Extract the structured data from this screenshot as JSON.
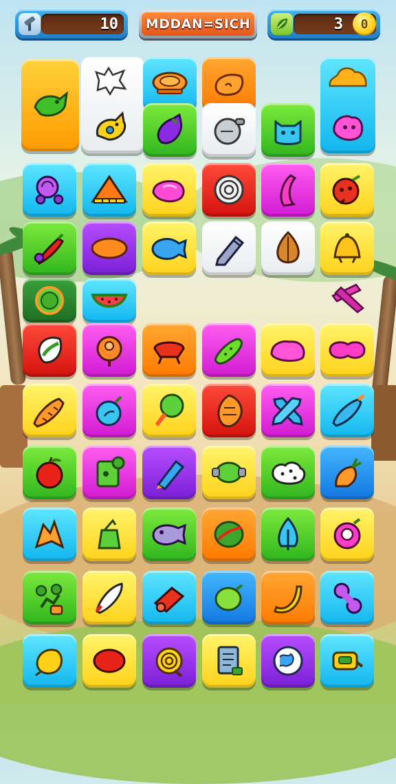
{
  "hud": {
    "title": "MDDAN=SICH",
    "left_counter": {
      "icon": "hammer-icon",
      "value": "10"
    },
    "right_counter": {
      "icon": "leaf-icon",
      "value": "3",
      "coin_label": "0"
    }
  },
  "colors": {
    "yellow": "#ffd21a",
    "orange": "#ff7a00",
    "cyan": "#12b6ee",
    "blue": "#1277e0",
    "green": "#2fb51e",
    "purple": "#7a1fd6",
    "magenta": "#d11ad3",
    "red": "#d4120e",
    "white": "#ffffff"
  },
  "board": {
    "tiles": [
      {
        "id": "t01",
        "color": "orangeyellow",
        "icon": "green-fish-icon"
      },
      {
        "id": "t02",
        "color": "white",
        "icon": "white-splat-icon"
      },
      {
        "id": "t03",
        "color": "cyan",
        "icon": "orange-bowl-icon"
      },
      {
        "id": "t04",
        "color": "orange",
        "icon": "orange-bean-icon"
      },
      {
        "id": "t05",
        "color": "cyan",
        "icon": "orange-blob-icon"
      },
      {
        "id": "t06",
        "color": "white",
        "icon": "yellow-bird-icon"
      },
      {
        "id": "t07",
        "color": "green",
        "icon": "purple-eggplant-icon"
      },
      {
        "id": "t08",
        "color": "white",
        "icon": "grey-pot-icon"
      },
      {
        "id": "t09",
        "color": "green",
        "icon": "blue-cat-icon"
      },
      {
        "id": "t10",
        "color": "cyan",
        "icon": "pink-face-icon"
      },
      {
        "id": "t11",
        "color": "cyan",
        "icon": "purple-snail-icon"
      },
      {
        "id": "t12",
        "color": "cyan",
        "icon": "triangle-ruler-icon"
      },
      {
        "id": "t13",
        "color": "yellow",
        "icon": "pink-lip-icon"
      },
      {
        "id": "t14",
        "color": "red",
        "icon": "spiral-shell-icon"
      },
      {
        "id": "t15",
        "color": "magenta",
        "icon": "pink-banana-icon"
      },
      {
        "id": "t16",
        "color": "yellow",
        "icon": "red-bug-icon"
      },
      {
        "id": "t17",
        "color": "green",
        "icon": "chili-pepper-icon"
      },
      {
        "id": "t18",
        "color": "purple",
        "icon": "orange-disc-icon"
      },
      {
        "id": "t19",
        "color": "yellow",
        "icon": "blue-fish-icon"
      },
      {
        "id": "t20",
        "color": "white",
        "icon": "grey-pencil-icon"
      },
      {
        "id": "t21",
        "color": "white",
        "icon": "onion-icon"
      },
      {
        "id": "t22",
        "color": "yellow",
        "icon": "bell-icon"
      },
      {
        "id": "t23",
        "color": "dkgreen",
        "icon": "green-ring-icon"
      },
      {
        "id": "t24",
        "color": "cyan",
        "icon": "watermelon-icon"
      },
      {
        "id": "t25",
        "color": "none",
        "icon": "pink-cross-icon"
      },
      {
        "id": "t26",
        "color": "red",
        "icon": "green-leaf-icon"
      },
      {
        "id": "t27",
        "color": "magenta",
        "icon": "orange-gem-icon"
      },
      {
        "id": "t28",
        "color": "orange",
        "icon": "red-crab-icon"
      },
      {
        "id": "t29",
        "color": "magenta",
        "icon": "green-pickle-icon"
      },
      {
        "id": "t30",
        "color": "yellow",
        "icon": "pink-slime-icon"
      },
      {
        "id": "t31",
        "color": "yellow",
        "icon": "pink-bean-icon"
      },
      {
        "id": "t32",
        "color": "yellow",
        "icon": "carrot-icon"
      },
      {
        "id": "t33",
        "color": "magenta",
        "icon": "blue-fruit-icon"
      },
      {
        "id": "t34",
        "color": "yellow",
        "icon": "green-lollipop-icon"
      },
      {
        "id": "t35",
        "color": "red",
        "icon": "orange-nut-icon"
      },
      {
        "id": "t36",
        "color": "magenta",
        "icon": "blue-bone-icon"
      },
      {
        "id": "t37",
        "color": "cyan",
        "icon": "blue-rocket-icon"
      },
      {
        "id": "t38",
        "color": "green",
        "icon": "red-apple-icon"
      },
      {
        "id": "t39",
        "color": "magenta",
        "icon": "green-card-icon"
      },
      {
        "id": "t40",
        "color": "purple",
        "icon": "blue-pen-icon"
      },
      {
        "id": "t41",
        "color": "yellow",
        "icon": "green-ring-bead-icon"
      },
      {
        "id": "t42",
        "color": "green",
        "icon": "white-cookie-icon"
      },
      {
        "id": "t43",
        "color": "blue",
        "icon": "orange-radish-icon"
      },
      {
        "id": "t44",
        "color": "cyan",
        "icon": "orange-leaf-icon"
      },
      {
        "id": "t45",
        "color": "yellow",
        "icon": "green-bag-icon"
      },
      {
        "id": "t46",
        "color": "green",
        "icon": "purple-fish-icon"
      },
      {
        "id": "t47",
        "color": "orange",
        "icon": "green-melon-icon"
      },
      {
        "id": "t48",
        "color": "green",
        "icon": "blue-tree-icon"
      },
      {
        "id": "t49",
        "color": "yellow",
        "icon": "pink-donut-icon"
      },
      {
        "id": "t50",
        "color": "green",
        "icon": "flower-pot-icon"
      },
      {
        "id": "t51",
        "color": "yellow",
        "icon": "white-feather-icon"
      },
      {
        "id": "t52",
        "color": "cyan",
        "icon": "red-log-icon"
      },
      {
        "id": "t53",
        "color": "blue",
        "icon": "green-lemon-icon"
      },
      {
        "id": "t54",
        "color": "orange",
        "icon": "yellow-banana-icon"
      },
      {
        "id": "t55",
        "color": "cyan",
        "icon": "purple-bone-icon"
      },
      {
        "id": "t56",
        "color": "cyan",
        "icon": "yellow-drop-icon"
      },
      {
        "id": "t57",
        "color": "yellow",
        "icon": "red-berry-icon"
      },
      {
        "id": "t58",
        "color": "purple",
        "icon": "yellow-spiral-icon"
      },
      {
        "id": "t59",
        "color": "yellow",
        "icon": "note-page-icon"
      },
      {
        "id": "t60",
        "color": "purple",
        "icon": "globe-icon"
      },
      {
        "id": "t61",
        "color": "cyan",
        "icon": "yellow-tape-icon"
      }
    ]
  }
}
